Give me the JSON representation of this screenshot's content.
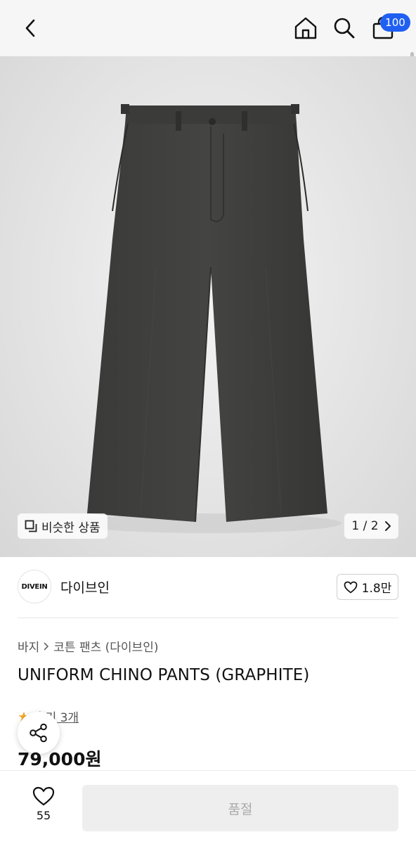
{
  "header": {
    "back_icon": "chevron-left-icon",
    "home_icon": "home-icon",
    "search_icon": "search-icon",
    "bag_icon": "shopping-bag-icon",
    "bag_count": "100",
    "badge_color": "#1f5ff2"
  },
  "gallery": {
    "similar_label": "비슷한 상품",
    "similar_icon": "copy-icon",
    "page_indicator": "1 / 2",
    "next_icon": "chevron-right-icon"
  },
  "brand": {
    "logo_text": "DIVEIN",
    "name": "다이브인",
    "like_count": "1.8만",
    "heart_icon": "heart-outline-icon"
  },
  "breadcrumb": {
    "category": "바지",
    "subcategory": "코튼 팬츠 (다이브인)"
  },
  "product": {
    "title": "UNIFORM CHINO PANTS (GRAPHITE)",
    "review_text": "후기 3개",
    "price": "79,000원"
  },
  "share": {
    "icon": "share-icon"
  },
  "bottom": {
    "wish_count": "55",
    "soldout_label": "품절"
  }
}
